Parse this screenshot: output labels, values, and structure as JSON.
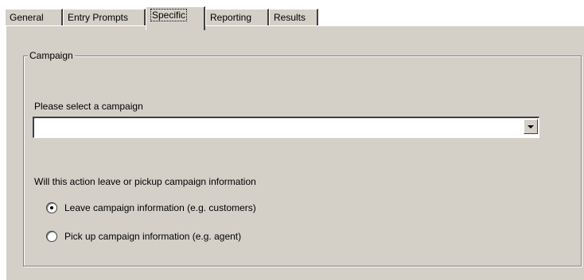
{
  "tabs": [
    {
      "label": "General",
      "active": false
    },
    {
      "label": "Entry Prompts",
      "active": false
    },
    {
      "label": "Specific",
      "active": true
    },
    {
      "label": "Reporting",
      "active": false
    },
    {
      "label": "Results",
      "active": false
    }
  ],
  "campaign_group": {
    "title": "Campaign",
    "select_label": "Please select a campaign",
    "select_value": "",
    "question": "Will this action leave or pickup campaign information",
    "options": [
      {
        "label": "Leave campaign information (e.g. customers)",
        "checked": true
      },
      {
        "label": "Pick up campaign information (e.g. agent)",
        "checked": false
      }
    ]
  },
  "colors": {
    "dialog_background": "#d4d0c8",
    "highlight": "#ffffff",
    "shadow": "#404040"
  },
  "icons": {
    "dropdown": "chevron-down-icon"
  }
}
